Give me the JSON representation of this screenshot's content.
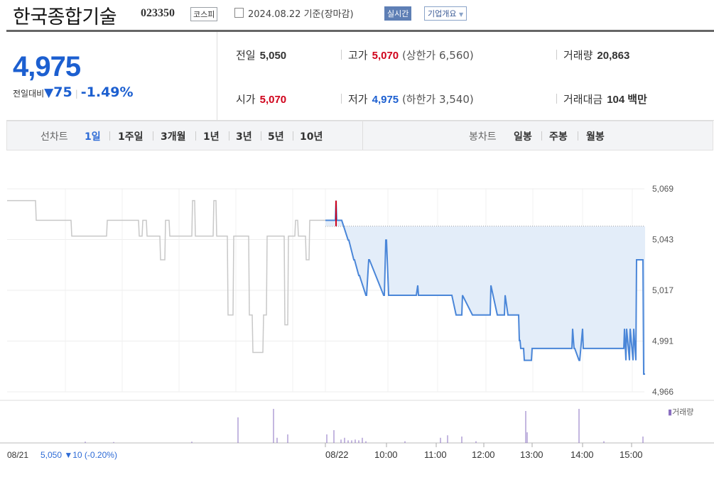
{
  "header": {
    "name": "한국종합기술",
    "code": "023350",
    "market": "코스피",
    "date": "2024.08.22",
    "basis": "기준(장마감)",
    "realtime_label": "실시간",
    "company_label": "기업개요"
  },
  "quote": {
    "price": "4,975",
    "change_label": "전일대비",
    "change_arrow": "▼",
    "change": "75",
    "change_pct": "-1.49%",
    "prev_close_label": "전일",
    "prev_close": "5,050",
    "high_label": "고가",
    "high": "5,070",
    "upper_limit": "(상한가 6,560)",
    "volume_label": "거래량",
    "volume": "20,863",
    "open_label": "시가",
    "open": "5,070",
    "low_label": "저가",
    "low": "4,975",
    "lower_limit": "(하한가 3,540)",
    "amount_label": "거래대금",
    "amount": "104",
    "amount_unit": "백만"
  },
  "tabs": {
    "line_label": "선차트",
    "line_periods": [
      "1일",
      "1주일",
      "3개월",
      "1년",
      "3년",
      "5년",
      "10년"
    ],
    "active": "1일",
    "candle_label": "봉차트",
    "candle_periods": [
      "일봉",
      "주봉",
      "월봉"
    ]
  },
  "colors": {
    "up": "#d0021b",
    "down": "#1c5fd0",
    "line_today": "#4a86d8",
    "line_prev": "#c8c8c8",
    "fill_today": "#e3edf9",
    "volume": "#8a6fc0"
  },
  "chart_data": {
    "type": "line",
    "y_ticks": [
      "5,069",
      "5,043",
      "5,017",
      "4,991",
      "4,966"
    ],
    "ylim": [
      4966,
      5069
    ],
    "x_ticks": [
      "08/21",
      "08/22",
      "10:00",
      "11:00",
      "12:00",
      "13:00",
      "14:00",
      "15:00"
    ],
    "prev_day_summary": "08/21  5,050 ▼10 (-0.20%)",
    "volume_legend": "거래량",
    "reference_price": 5050,
    "prev_session": {
      "x": [
        0,
        40,
        41,
        90,
        91,
        140,
        141,
        185,
        186,
        190,
        191,
        196,
        197,
        215,
        216,
        222,
        223,
        228,
        229,
        260,
        261,
        264,
        265,
        290,
        291,
        294,
        295,
        310,
        311,
        318,
        319,
        340,
        341,
        345,
        346,
        360,
        361,
        365,
        366,
        390,
        391,
        395,
        396,
        405,
        406,
        409,
        410,
        420,
        421,
        425,
        426,
        438,
        439,
        448
      ],
      "y": [
        5063,
        5063,
        5053,
        5053,
        5045,
        5045,
        5053,
        5053,
        5045,
        5045,
        5053,
        5053,
        5045,
        5045,
        5033,
        5033,
        5053,
        5053,
        5045,
        5045,
        5063,
        5063,
        5045,
        5045,
        5063,
        5063,
        5045,
        5045,
        5005,
        5005,
        5045,
        5045,
        5005,
        5005,
        4986,
        4986,
        5005,
        5005,
        5045,
        5045,
        5000,
        5000,
        5045,
        5045,
        5053,
        5053,
        5045,
        5045,
        5033,
        5033,
        5053,
        5053,
        5053,
        5053
      ]
    },
    "today": {
      "x": [
        448,
        462,
        463,
        464,
        465,
        470,
        471,
        480,
        481,
        488,
        489,
        495,
        496,
        505,
        506,
        509,
        510,
        530,
        531,
        533,
        534,
        537,
        538,
        575,
        576,
        578,
        579,
        625,
        626,
        632,
        633,
        640,
        641,
        655,
        656,
        680,
        681,
        690,
        691,
        700,
        701,
        705,
        706,
        720,
        721,
        722,
        723,
        727,
        728,
        738,
        739,
        795,
        796,
        798,
        799,
        805,
        806,
        810,
        811,
        868,
        869,
        871,
        872,
        876,
        877,
        881,
        882,
        885,
        886,
        895,
        896,
        898
      ],
      "y": [
        5053,
        5053,
        5063,
        5053,
        5053,
        5053,
        5053,
        5043,
        5043,
        5033,
        5033,
        5025,
        5025,
        5015,
        5015,
        5033,
        5033,
        5015,
        5015,
        5043,
        5043,
        5015,
        5015,
        5015,
        5015,
        5020,
        5015,
        5015,
        5015,
        5005,
        5005,
        5005,
        5015,
        5005,
        5005,
        5005,
        5020,
        5005,
        5005,
        5005,
        5015,
        5005,
        5005,
        5005,
        4992,
        4992,
        4988,
        4988,
        4982,
        4982,
        4988,
        4988,
        4998,
        4988,
        4988,
        4982,
        4982,
        4998,
        4988,
        4988,
        4998,
        4982,
        4998,
        4982,
        4998,
        4982,
        4998,
        4982,
        5033,
        5033,
        4975,
        4975
      ]
    },
    "volume_bars": {
      "x": [
        110,
        150,
        260,
        325,
        375,
        380,
        395,
        450,
        460,
        470,
        475,
        480,
        485,
        490,
        495,
        500,
        505,
        560,
        610,
        620,
        640,
        660,
        730,
        732,
        805,
        840,
        895
      ],
      "level": [
        0.03,
        0.02,
        0.03,
        0.6,
        0.8,
        0.12,
        0.2,
        0.2,
        0.3,
        0.08,
        0.12,
        0.06,
        0.06,
        0.08,
        0.06,
        0.12,
        0.04,
        0.04,
        0.12,
        0.18,
        0.15,
        0.04,
        0.75,
        0.25,
        0.8,
        0.04,
        0.15
      ]
    }
  }
}
